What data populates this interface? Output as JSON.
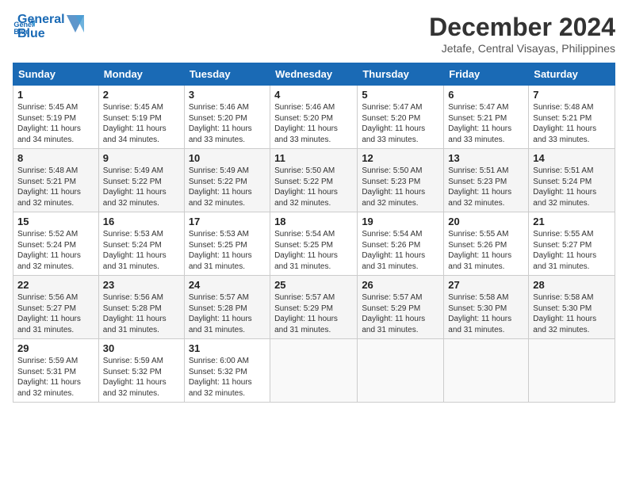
{
  "logo": {
    "line1": "General",
    "line2": "Blue"
  },
  "title": "December 2024",
  "location": "Jetafe, Central Visayas, Philippines",
  "days_of_week": [
    "Sunday",
    "Monday",
    "Tuesday",
    "Wednesday",
    "Thursday",
    "Friday",
    "Saturday"
  ],
  "weeks": [
    [
      {
        "day": "1",
        "sunrise": "5:45 AM",
        "sunset": "5:19 PM",
        "daylight": "11 hours and 34 minutes."
      },
      {
        "day": "2",
        "sunrise": "5:45 AM",
        "sunset": "5:19 PM",
        "daylight": "11 hours and 34 minutes."
      },
      {
        "day": "3",
        "sunrise": "5:46 AM",
        "sunset": "5:20 PM",
        "daylight": "11 hours and 33 minutes."
      },
      {
        "day": "4",
        "sunrise": "5:46 AM",
        "sunset": "5:20 PM",
        "daylight": "11 hours and 33 minutes."
      },
      {
        "day": "5",
        "sunrise": "5:47 AM",
        "sunset": "5:20 PM",
        "daylight": "11 hours and 33 minutes."
      },
      {
        "day": "6",
        "sunrise": "5:47 AM",
        "sunset": "5:21 PM",
        "daylight": "11 hours and 33 minutes."
      },
      {
        "day": "7",
        "sunrise": "5:48 AM",
        "sunset": "5:21 PM",
        "daylight": "11 hours and 33 minutes."
      }
    ],
    [
      {
        "day": "8",
        "sunrise": "5:48 AM",
        "sunset": "5:21 PM",
        "daylight": "11 hours and 32 minutes."
      },
      {
        "day": "9",
        "sunrise": "5:49 AM",
        "sunset": "5:22 PM",
        "daylight": "11 hours and 32 minutes."
      },
      {
        "day": "10",
        "sunrise": "5:49 AM",
        "sunset": "5:22 PM",
        "daylight": "11 hours and 32 minutes."
      },
      {
        "day": "11",
        "sunrise": "5:50 AM",
        "sunset": "5:22 PM",
        "daylight": "11 hours and 32 minutes."
      },
      {
        "day": "12",
        "sunrise": "5:50 AM",
        "sunset": "5:23 PM",
        "daylight": "11 hours and 32 minutes."
      },
      {
        "day": "13",
        "sunrise": "5:51 AM",
        "sunset": "5:23 PM",
        "daylight": "11 hours and 32 minutes."
      },
      {
        "day": "14",
        "sunrise": "5:51 AM",
        "sunset": "5:24 PM",
        "daylight": "11 hours and 32 minutes."
      }
    ],
    [
      {
        "day": "15",
        "sunrise": "5:52 AM",
        "sunset": "5:24 PM",
        "daylight": "11 hours and 32 minutes."
      },
      {
        "day": "16",
        "sunrise": "5:53 AM",
        "sunset": "5:24 PM",
        "daylight": "11 hours and 31 minutes."
      },
      {
        "day": "17",
        "sunrise": "5:53 AM",
        "sunset": "5:25 PM",
        "daylight": "11 hours and 31 minutes."
      },
      {
        "day": "18",
        "sunrise": "5:54 AM",
        "sunset": "5:25 PM",
        "daylight": "11 hours and 31 minutes."
      },
      {
        "day": "19",
        "sunrise": "5:54 AM",
        "sunset": "5:26 PM",
        "daylight": "11 hours and 31 minutes."
      },
      {
        "day": "20",
        "sunrise": "5:55 AM",
        "sunset": "5:26 PM",
        "daylight": "11 hours and 31 minutes."
      },
      {
        "day": "21",
        "sunrise": "5:55 AM",
        "sunset": "5:27 PM",
        "daylight": "11 hours and 31 minutes."
      }
    ],
    [
      {
        "day": "22",
        "sunrise": "5:56 AM",
        "sunset": "5:27 PM",
        "daylight": "11 hours and 31 minutes."
      },
      {
        "day": "23",
        "sunrise": "5:56 AM",
        "sunset": "5:28 PM",
        "daylight": "11 hours and 31 minutes."
      },
      {
        "day": "24",
        "sunrise": "5:57 AM",
        "sunset": "5:28 PM",
        "daylight": "11 hours and 31 minutes."
      },
      {
        "day": "25",
        "sunrise": "5:57 AM",
        "sunset": "5:29 PM",
        "daylight": "11 hours and 31 minutes."
      },
      {
        "day": "26",
        "sunrise": "5:57 AM",
        "sunset": "5:29 PM",
        "daylight": "11 hours and 31 minutes."
      },
      {
        "day": "27",
        "sunrise": "5:58 AM",
        "sunset": "5:30 PM",
        "daylight": "11 hours and 31 minutes."
      },
      {
        "day": "28",
        "sunrise": "5:58 AM",
        "sunset": "5:30 PM",
        "daylight": "11 hours and 32 minutes."
      }
    ],
    [
      {
        "day": "29",
        "sunrise": "5:59 AM",
        "sunset": "5:31 PM",
        "daylight": "11 hours and 32 minutes."
      },
      {
        "day": "30",
        "sunrise": "5:59 AM",
        "sunset": "5:32 PM",
        "daylight": "11 hours and 32 minutes."
      },
      {
        "day": "31",
        "sunrise": "6:00 AM",
        "sunset": "5:32 PM",
        "daylight": "11 hours and 32 minutes."
      },
      null,
      null,
      null,
      null
    ]
  ]
}
